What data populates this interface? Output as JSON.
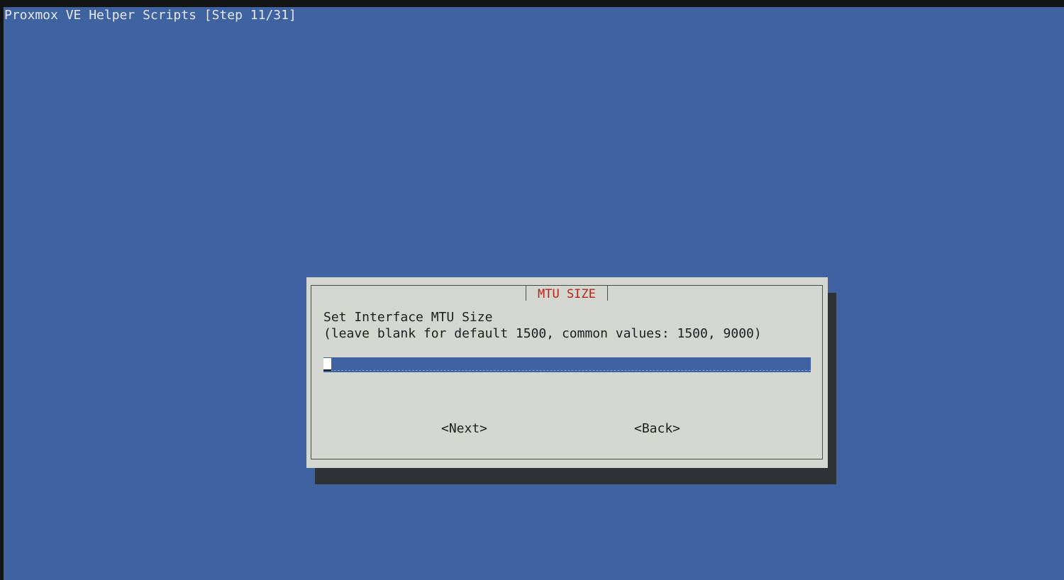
{
  "window": {
    "backtitle": "Proxmox VE Helper Scripts [Step 11/31]"
  },
  "dialog": {
    "title": "MTU SIZE",
    "prompt_line1": "Set Interface MTU Size",
    "prompt_line2": "(leave blank for default 1500, common values: 1500, 9000)",
    "input": {
      "value": ""
    },
    "buttons": {
      "next_label": "<Next>",
      "back_label": "<Back>"
    }
  },
  "colors": {
    "background": "#3f62a0",
    "dialog": "#d4d6d0",
    "title": "#b8241c",
    "shadow": "#2f3236"
  }
}
